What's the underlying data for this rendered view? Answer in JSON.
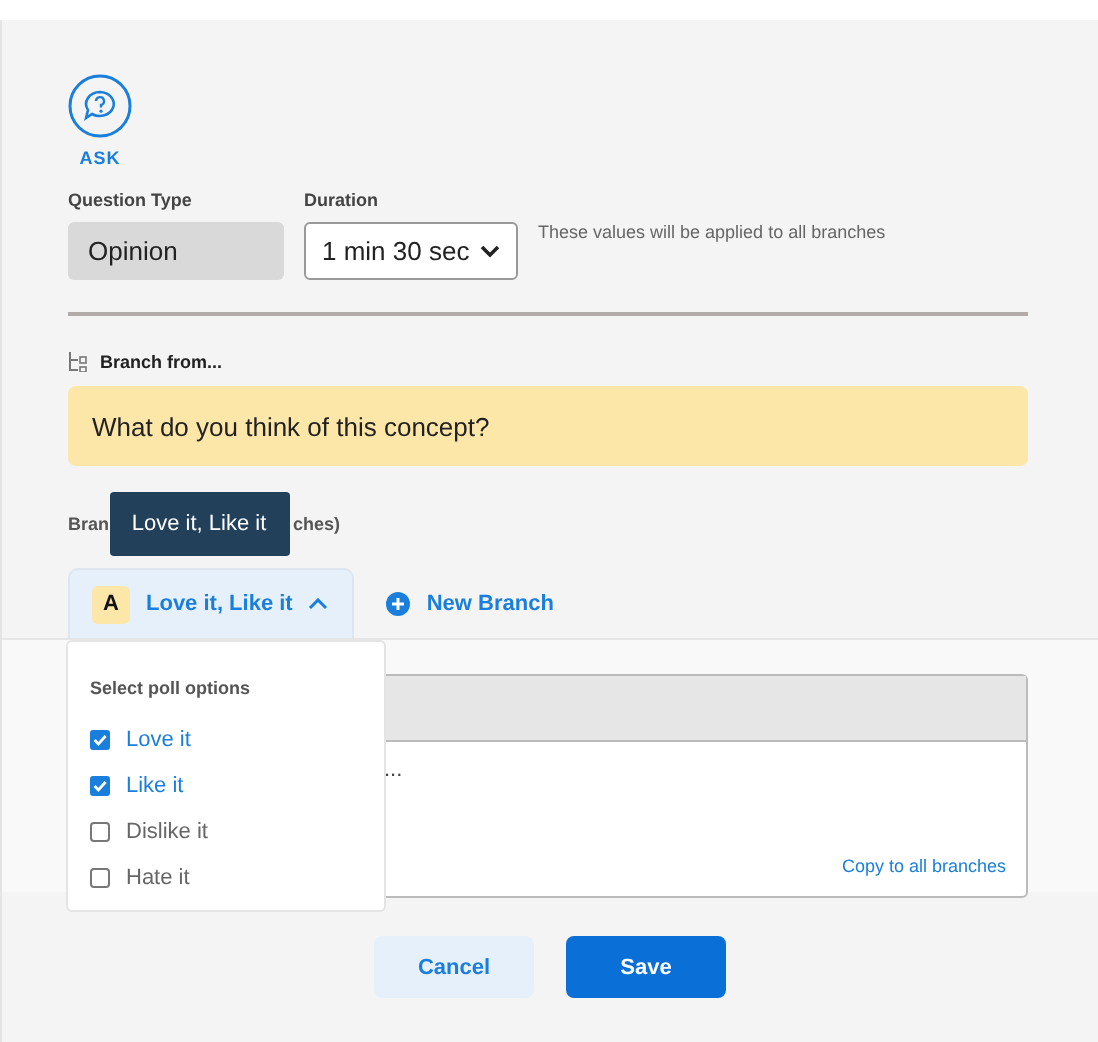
{
  "header": {
    "icon_label": "ASK"
  },
  "question_type": {
    "label": "Question Type",
    "value": "Opinion"
  },
  "duration": {
    "label": "Duration",
    "value": "1 min 30 sec"
  },
  "note": "These values will be applied to all branches",
  "branch_from": {
    "label": "Branch from...",
    "question": "What do you think of this concept?"
  },
  "branches_label": {
    "start": "Bran",
    "end": "ches)"
  },
  "tooltip": "Love it, Like it",
  "tabs": [
    {
      "letter": "A",
      "label": "Love it, Like it",
      "selected": true,
      "expanded": true
    }
  ],
  "new_branch": "New Branch",
  "editor": {
    "fragment": "...",
    "link": "Copy to all branches"
  },
  "dropdown": {
    "title": "Select poll options",
    "options": [
      {
        "label": "Love it",
        "checked": true
      },
      {
        "label": "Like it",
        "checked": true
      },
      {
        "label": "Dislike it",
        "checked": false
      },
      {
        "label": "Hate it",
        "checked": false
      }
    ]
  },
  "buttons": [
    {
      "label": "Cancel",
      "kind": "secondary"
    },
    {
      "label": "Save",
      "kind": "primary"
    }
  ]
}
